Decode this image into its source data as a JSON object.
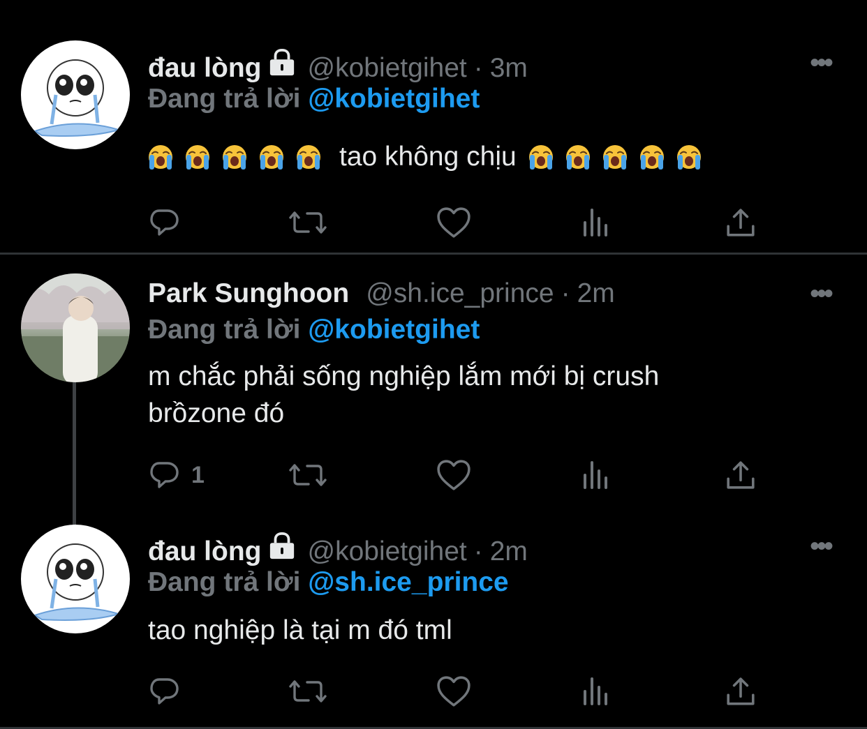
{
  "tweets": [
    {
      "name": "đau lòng",
      "handle": "@kobietgihet",
      "time": "3m",
      "reply_prefix": "Đang trả lời",
      "reply_to": "@kobietgihet",
      "text": "tao không chịu",
      "reply_count": "",
      "avatar": "crying-doodle"
    },
    {
      "name": "Park Sunghoon",
      "handle": "@sh.ice_prince",
      "time": "2m",
      "reply_prefix": "Đang trả lời",
      "reply_to": "@kobietgihet",
      "text_line1": "m chắc phải sống nghiệp lắm mới bị crush",
      "text_line2": "brồzone đó",
      "reply_count": "1",
      "avatar": "photo"
    },
    {
      "name": "đau lòng",
      "handle": "@kobietgihet",
      "time": "2m",
      "reply_prefix": "Đang trả lời",
      "reply_to": "@sh.ice_prince",
      "text": "tao nghiệp là tại m đó tml",
      "reply_count": "",
      "avatar": "crying-doodle"
    }
  ],
  "dot_separator": "·",
  "more_glyph": "•••",
  "icons": [
    "reply-icon",
    "retweet-icon",
    "like-icon",
    "analytics-icon",
    "share-icon",
    "lock-icon",
    "more-icon",
    "loudly-crying-face-emoji"
  ],
  "colors": {
    "background": "#000000",
    "primary_text": "#e7e9ea",
    "secondary_text": "#71767b",
    "link": "#1d9bf0",
    "divider": "#2f3336"
  }
}
